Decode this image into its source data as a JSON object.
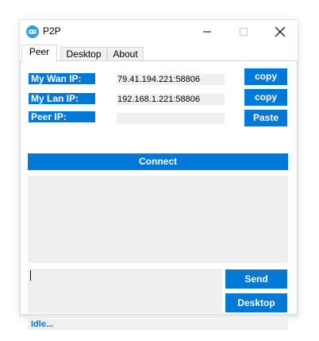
{
  "window": {
    "title": "P2P",
    "accent_color": "#0078d7",
    "icon": "p2p-app-icon"
  },
  "tabs": [
    {
      "label": "Peer",
      "active": true
    },
    {
      "label": "Desktop",
      "active": false
    },
    {
      "label": "About",
      "active": false
    }
  ],
  "peer": {
    "wan_label": "My Wan IP:",
    "wan_value": "79.41.194.221:58806",
    "lan_label": "My Lan IP:",
    "lan_value": "192.168.1.221:58806",
    "peer_label": "Peer IP:",
    "peer_value": "",
    "copy_wan_label": "copy",
    "copy_lan_label": "copy",
    "paste_label": "Paste",
    "connect_label": "Connect",
    "log_text": "",
    "message_input_value": "",
    "send_label": "Send",
    "desktop_label": "Desktop",
    "status": "Idle..."
  }
}
